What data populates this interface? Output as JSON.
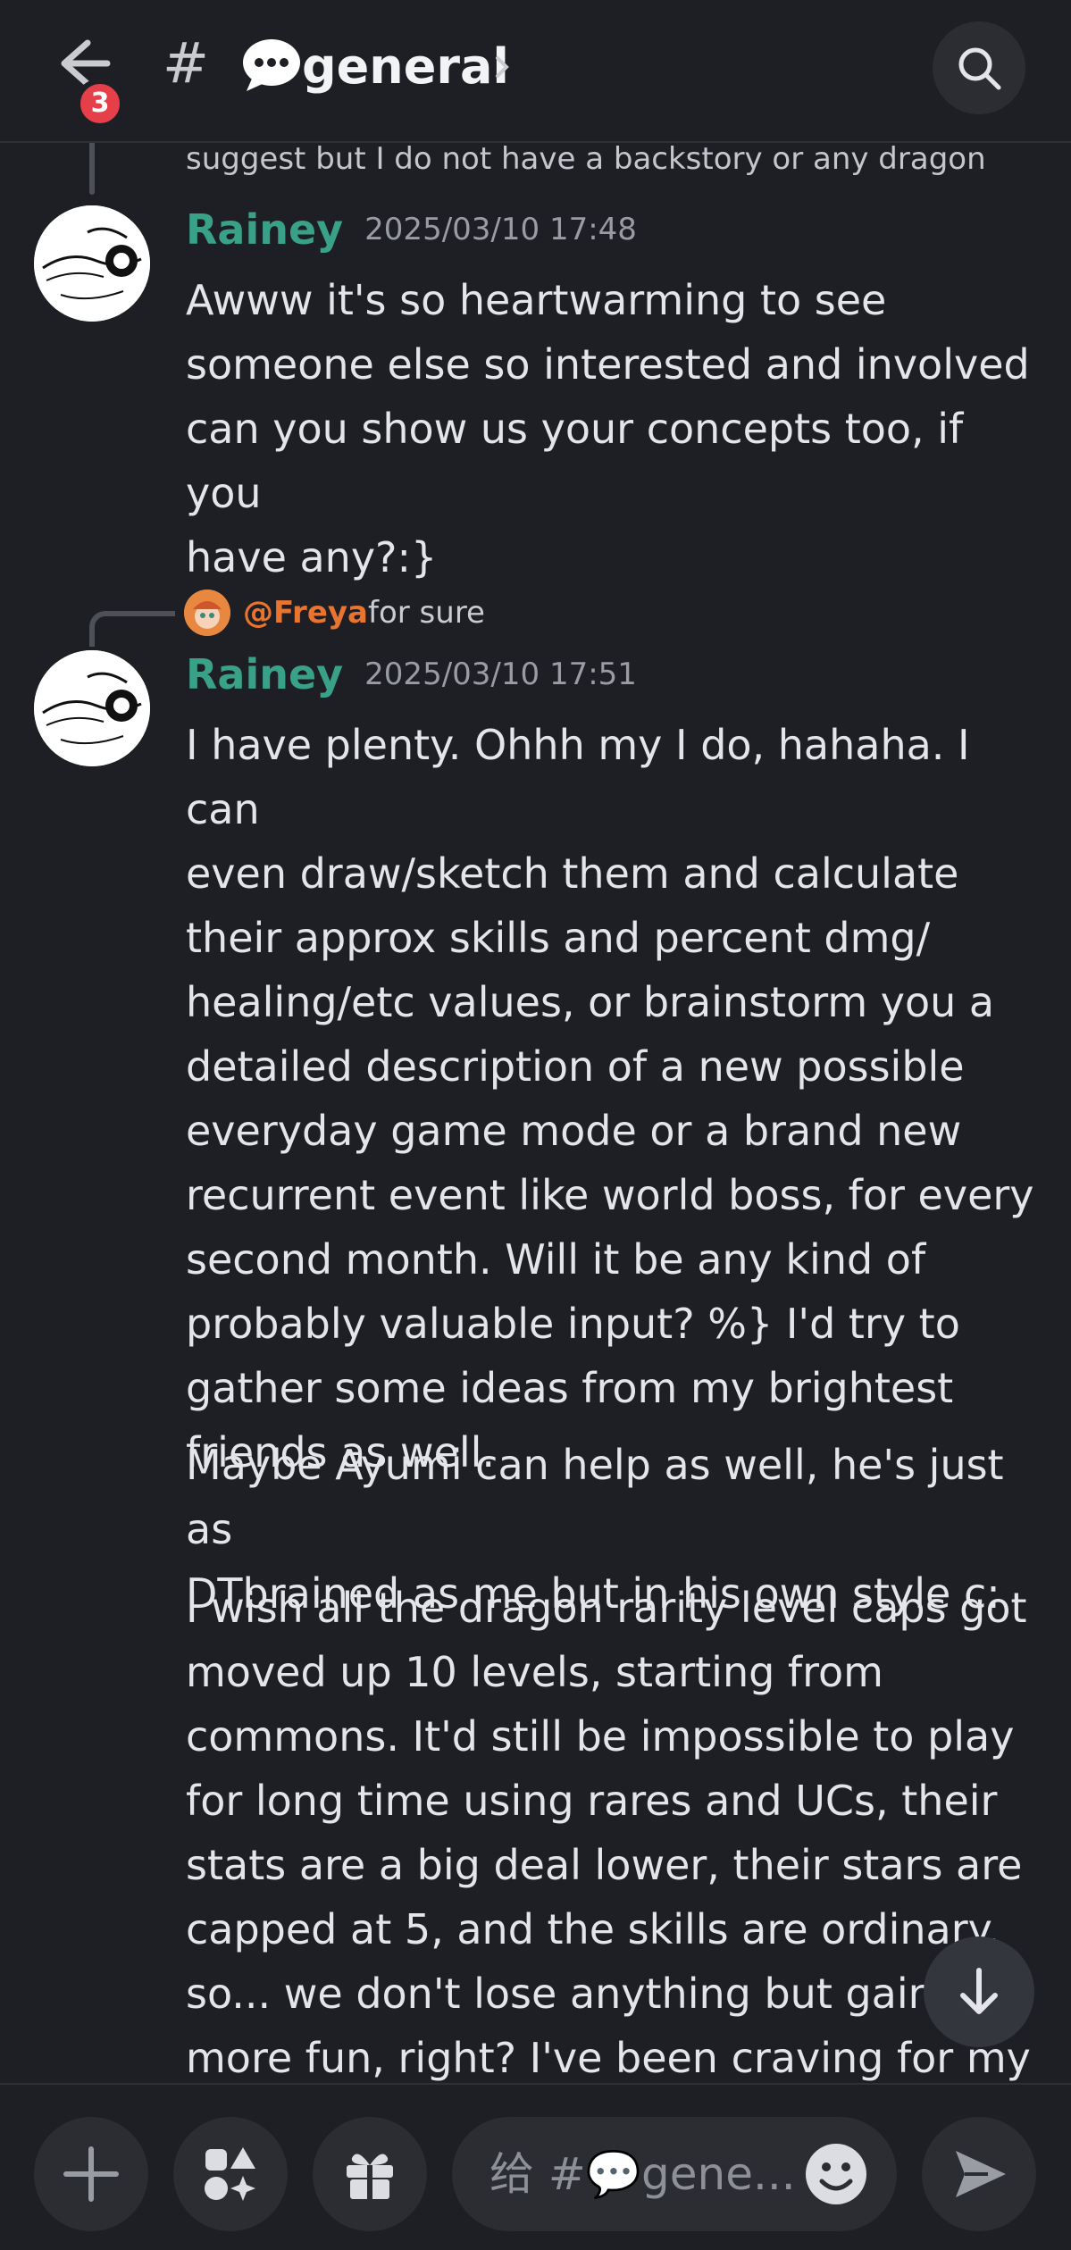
{
  "header": {
    "unread_badge": "3",
    "channel_hash": "#",
    "channel_name": "general",
    "icons": [
      "back-arrow-icon",
      "speech-bubble-icon",
      "chevron-right-icon",
      "search-icon"
    ]
  },
  "chat": {
    "continuation_text": "suggest but I do not have a backstory or any dragon",
    "messages": [
      {
        "author": "Rainey",
        "timestamp": "2025/03/10 17:48",
        "paragraphs": [
          "Awww it's so heartwarming to see\nsomeone else so interested and involved\ncan you show us your concepts too, if you\nhave any?:}"
        ]
      },
      {
        "reply_to": {
          "mention": "@Freya",
          "text": "for sure"
        },
        "author": "Rainey",
        "timestamp": "2025/03/10 17:51",
        "paragraphs": [
          "I have plenty. Ohhh my I do, hahaha. I can\neven draw/sketch them and calculate\ntheir approx skills and percent dmg/\nhealing/etc values, or brainstorm you a\ndetailed description of a new possible\neveryday game mode or a brand new\nrecurrent event like world boss, for every\nsecond month. Will it be any kind of\nprobably valuable input? %} I'd try to\ngather some ideas from my brightest\nfriends as well.",
          "Maybe Ayumi can help as well, he's just as\nDTbrained as me but in his own style c:",
          "I wish all the dragon rarity level caps got\nmoved up 10 levels, starting from\ncommons. It'd still be impossible to play\nfor long time using rares and UCs, their\nstats are a big deal lower, their stars are\ncapped at 5, and the skills are ordinary.\nso... we don't lose anything but gain so\nmore fun, right? I've been craving for my"
        ]
      }
    ]
  },
  "composer": {
    "placeholder": "给 #💬gene...",
    "icons": [
      "plus-icon",
      "apps-icon",
      "gift-icon",
      "emoji-icon",
      "send-icon"
    ]
  },
  "colors": {
    "background": "#1e1f24",
    "author": "#3aa189",
    "mention": "#e8742f",
    "badge": "#e5404a"
  }
}
